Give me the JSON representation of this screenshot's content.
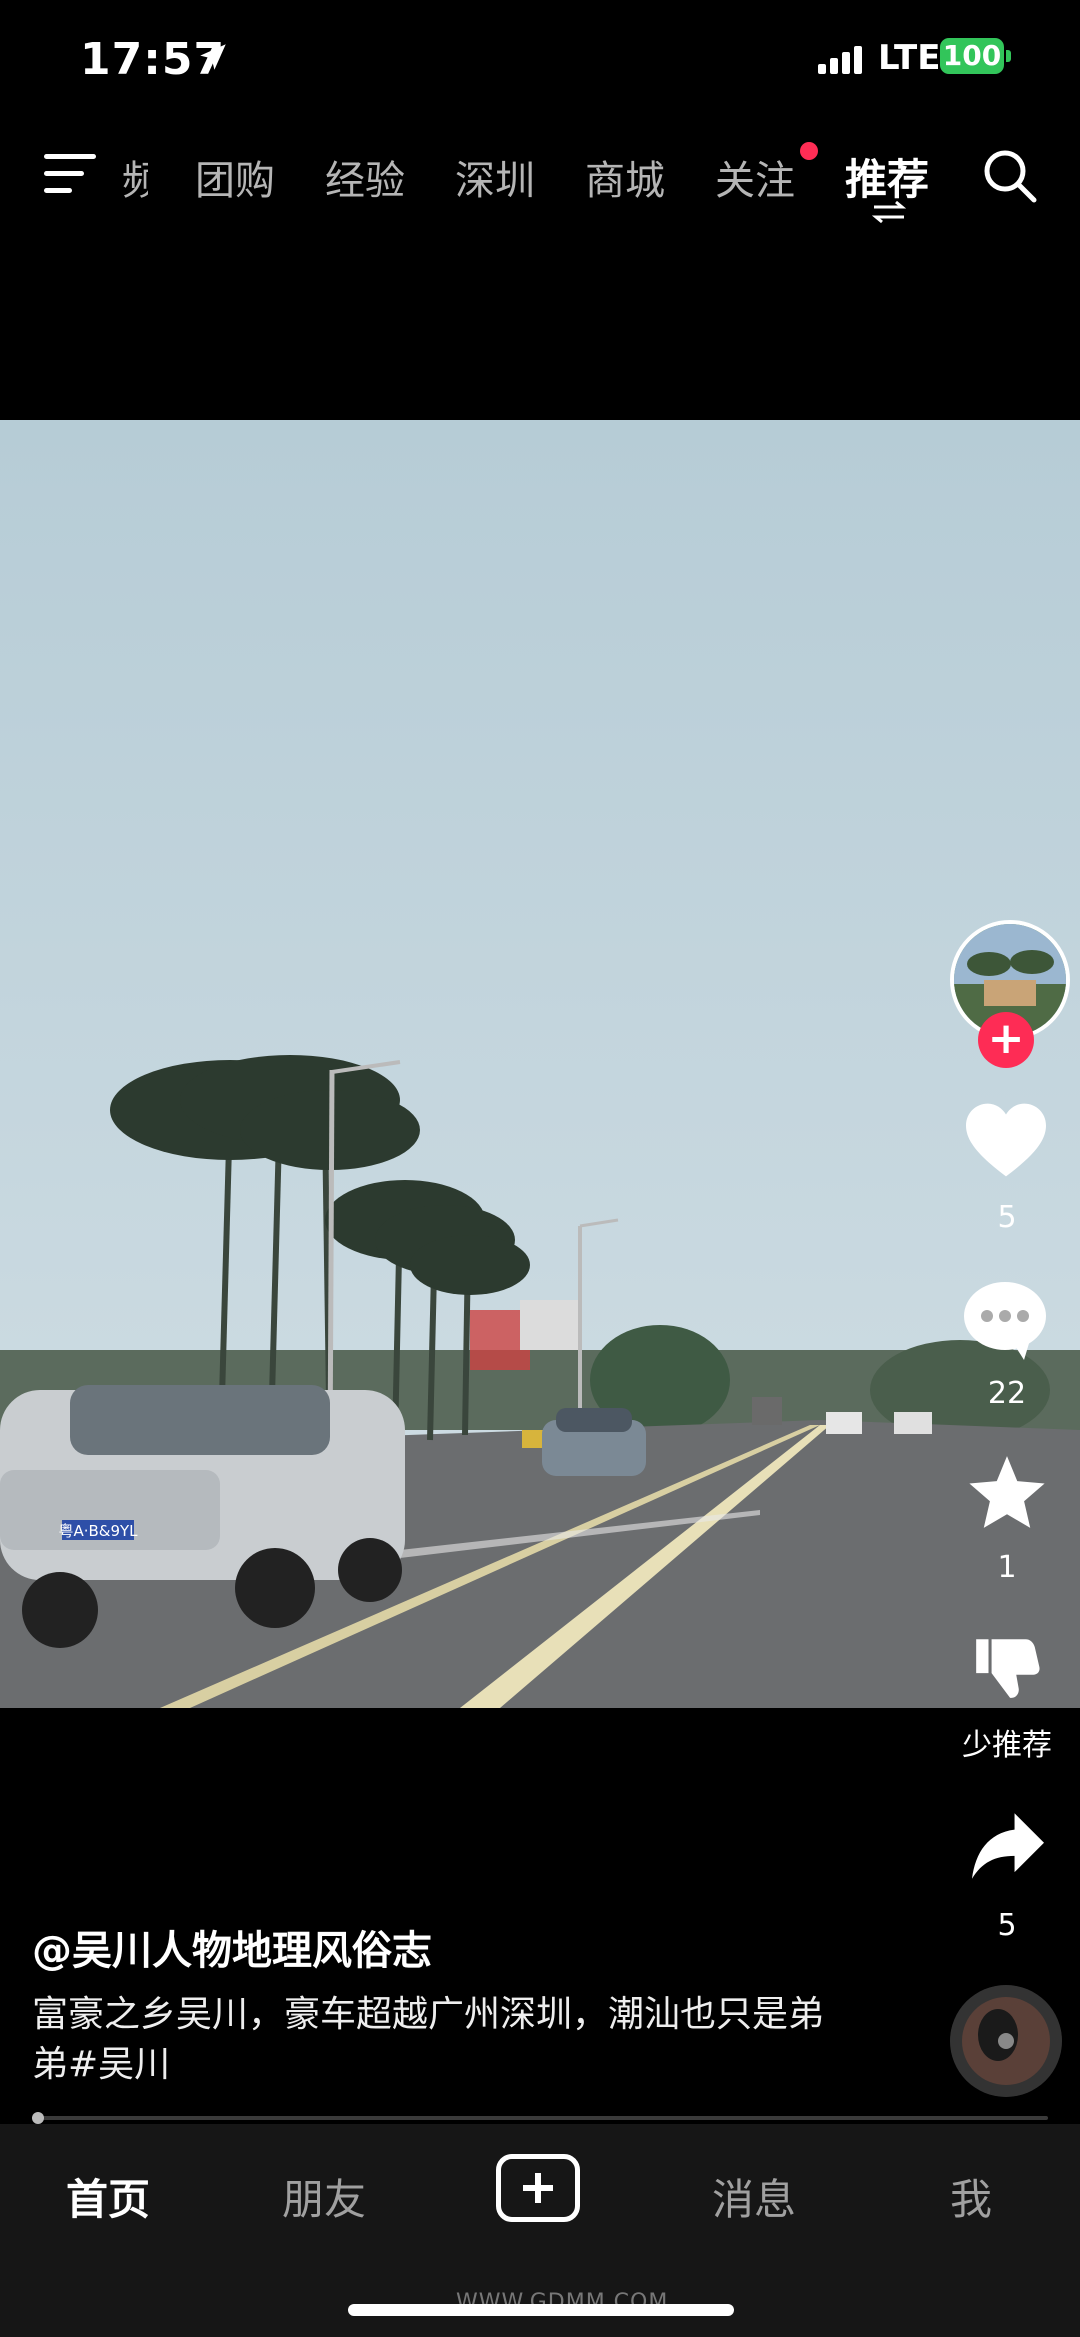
{
  "status_bar": {
    "time": "17:57",
    "network": "LTE",
    "battery": "100"
  },
  "top_nav": {
    "tabs": [
      {
        "label": "频",
        "partial": true
      },
      {
        "label": "团购"
      },
      {
        "label": "经验"
      },
      {
        "label": "深圳"
      },
      {
        "label": "商城"
      },
      {
        "label": "关注",
        "has_dot": true
      },
      {
        "label": "推荐",
        "active": true
      }
    ]
  },
  "rail": {
    "like_count": "5",
    "comment_count": "22",
    "collect_count": "1",
    "dislike_label": "少推荐",
    "share_count": "5"
  },
  "post": {
    "author": "@吴川人物地理风俗志",
    "caption": "富豪之乡吴川，豪车超越广州深圳，潮汕也只是弟弟#吴川"
  },
  "video": {
    "plate": "粤A·B&9YL"
  },
  "bottom_nav": {
    "home": "首页",
    "friends": "朋友",
    "messages": "消息",
    "me": "我"
  },
  "watermark": "WWW.GDMM.COM",
  "colors": {
    "accent": "#fe2c55",
    "battery": "#32c55a"
  }
}
